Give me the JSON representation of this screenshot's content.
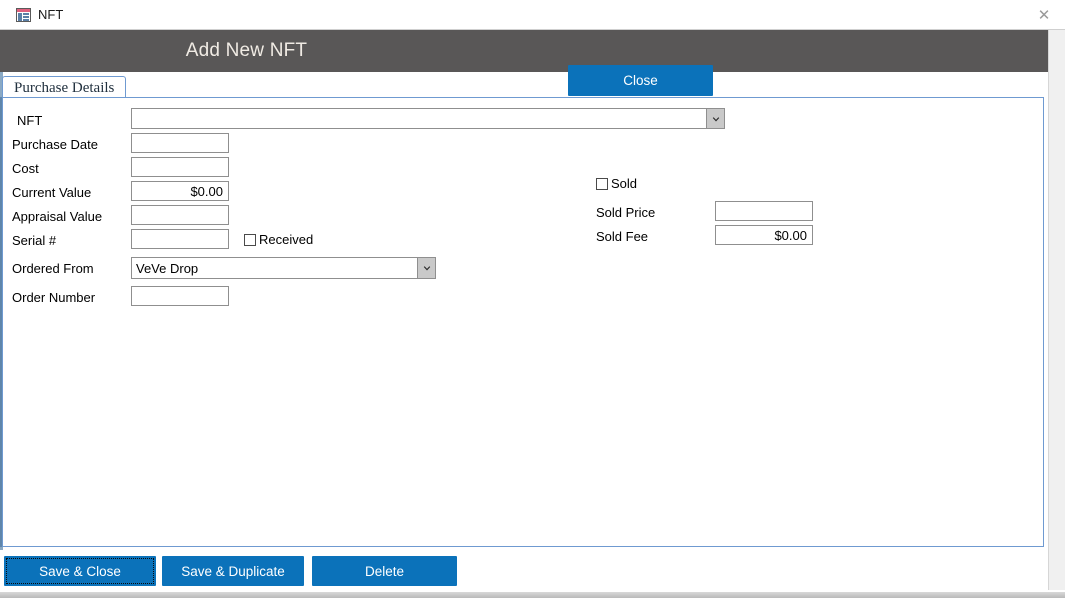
{
  "window": {
    "doc_tab_label": "NFT",
    "doc_tab_icon": "access-form-icon",
    "close_icon": "close-icon",
    "close_glyph": "✕"
  },
  "header": {
    "title": "Add New NFT",
    "close_label": "Close",
    "background_color": "#595757",
    "title_color": "#f0ebe4",
    "button_color": "#0b72ba"
  },
  "tabs": [
    {
      "label": "Purchase Details",
      "selected": true
    }
  ],
  "form": {
    "left_fields": [
      {
        "name": "nft",
        "label": "NFT",
        "type": "combobox",
        "value": "",
        "dropdown_icon": "chevron-down-icon"
      },
      {
        "name": "purchase-date",
        "label": "Purchase Date",
        "type": "text",
        "value": ""
      },
      {
        "name": "cost",
        "label": "Cost",
        "type": "text",
        "value": ""
      },
      {
        "name": "current-value",
        "label": "Current Value",
        "type": "currency",
        "value": "$0.00"
      },
      {
        "name": "appraisal-value",
        "label": "Appraisal Value",
        "type": "text",
        "value": ""
      },
      {
        "name": "serial-number",
        "label": "Serial #",
        "type": "text",
        "value": ""
      },
      {
        "name": "ordered-from",
        "label": "Ordered From",
        "type": "combobox",
        "value": "VeVe Drop",
        "dropdown_icon": "chevron-down-icon"
      },
      {
        "name": "order-number",
        "label": "Order Number",
        "type": "text",
        "value": ""
      }
    ],
    "received_checkbox": {
      "label": "Received",
      "checked": false
    },
    "right_fields": {
      "sold_checkbox": {
        "label": "Sold",
        "checked": false
      },
      "fields": [
        {
          "name": "sold-price",
          "label": "Sold Price",
          "type": "text",
          "value": ""
        },
        {
          "name": "sold-fee",
          "label": "Sold Fee",
          "type": "currency",
          "value": "$0.00"
        }
      ]
    }
  },
  "footer": {
    "buttons": [
      {
        "name": "save-and-close",
        "label": "Save & Close",
        "focused": true
      },
      {
        "name": "save-and-duplicate",
        "label": "Save & Duplicate",
        "focused": false
      },
      {
        "name": "delete",
        "label": "Delete",
        "focused": false
      }
    ]
  }
}
